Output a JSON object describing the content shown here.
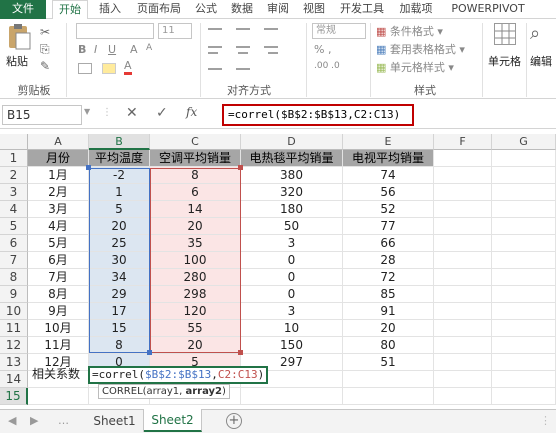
{
  "ribbon_tabs": [
    "文件",
    "开始",
    "插入",
    "页面布局",
    "公式",
    "数据",
    "审阅",
    "视图",
    "开发工具",
    "加载项",
    "POWERPIVOT"
  ],
  "ribbon": {
    "paste_label": "粘贴",
    "clipboard_label": "剪贴板",
    "align_label": "对齐方式",
    "number_format": "常规",
    "styles_label": "样式",
    "cond_format": "条件格式",
    "table_format": "套用表格格式",
    "cell_styles": "单元格样式",
    "cells_label": "单元格",
    "edit_label": "编辑",
    "font_size": "11"
  },
  "formula_bar": {
    "name_box": "B15",
    "fx": "fx",
    "formula": "=correl($B$2:$B$13,C2:C13)"
  },
  "columns": [
    "A",
    "B",
    "C",
    "D",
    "E",
    "F",
    "G"
  ],
  "headers": [
    "月份",
    "平均温度",
    "空调平均销量",
    "电热毯平均销量",
    "电视平均销量"
  ],
  "rows": [
    [
      "1月",
      "-2",
      "8",
      "380",
      "74"
    ],
    [
      "2月",
      "1",
      "6",
      "320",
      "56"
    ],
    [
      "3月",
      "5",
      "14",
      "180",
      "52"
    ],
    [
      "4月",
      "20",
      "20",
      "50",
      "77"
    ],
    [
      "5月",
      "25",
      "35",
      "3",
      "66"
    ],
    [
      "6月",
      "30",
      "100",
      "0",
      "28"
    ],
    [
      "7月",
      "34",
      "280",
      "0",
      "72"
    ],
    [
      "8月",
      "29",
      "298",
      "0",
      "85"
    ],
    [
      "9月",
      "17",
      "120",
      "3",
      "91"
    ],
    [
      "10月",
      "15",
      "55",
      "10",
      "20"
    ],
    [
      "11月",
      "8",
      "20",
      "150",
      "80"
    ],
    [
      "12月",
      "0",
      "5",
      "297",
      "51"
    ]
  ],
  "row15": {
    "label": "相关系数",
    "edit_prefix": "=correl(",
    "edit_ref1": "$B$2:$B$13",
    "edit_comma": ",",
    "edit_ref2": "C2:C13",
    "edit_suffix": ")",
    "tooltip_fn": "CORREL(array1, ",
    "tooltip_arg2": "array2",
    "tooltip_close": ")"
  },
  "sheets": [
    "Sheet1",
    "Sheet2"
  ],
  "colors": {
    "excel_green": "#217346",
    "ref_blue": "#4472c4",
    "ref_red": "#c0504d",
    "header_fill": "#a6a6a6"
  }
}
